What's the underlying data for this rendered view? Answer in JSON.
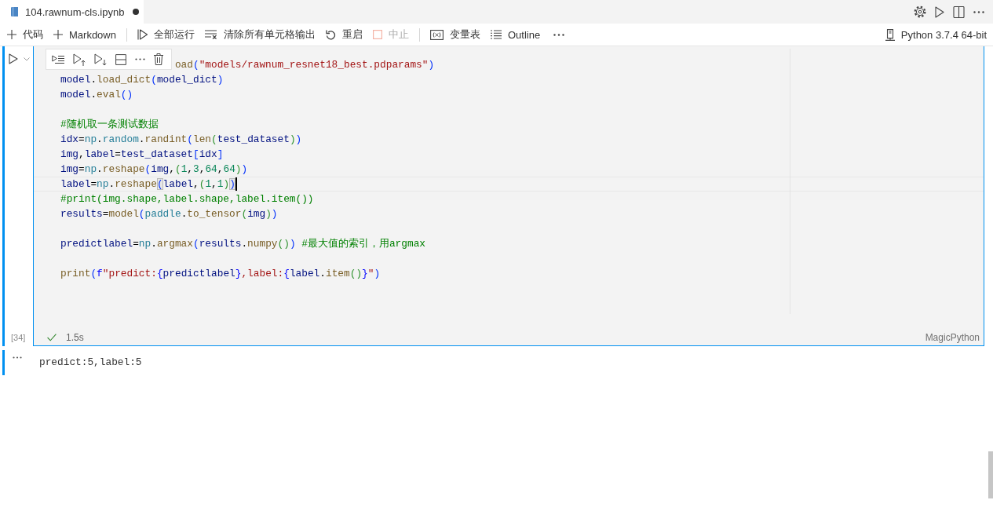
{
  "tab": {
    "title": "104.rawnum-cls.ipynb",
    "modified": true
  },
  "toolbar": {
    "groups": [
      [
        {
          "kind": "add",
          "label": "代码",
          "disabled": false
        },
        {
          "kind": "add",
          "label": "Markdown",
          "disabled": false
        }
      ],
      [
        {
          "kind": "run-all",
          "label": "全部运行",
          "disabled": false
        },
        {
          "kind": "clear",
          "label": "清除所有单元格输出",
          "disabled": false
        },
        {
          "kind": "restart",
          "label": "重启",
          "disabled": false
        },
        {
          "kind": "interrupt",
          "label": "中止",
          "disabled": true
        }
      ],
      [
        {
          "kind": "variables",
          "label": "变量表",
          "disabled": false
        },
        {
          "kind": "outline",
          "label": "Outline",
          "disabled": false
        }
      ]
    ]
  },
  "kernel": {
    "label": "Python 3.7.4 64-bit"
  },
  "cell": {
    "execution_count": "[34]",
    "succeeded": true,
    "duration": "1.5s",
    "language": "MagicPython",
    "lines": [
      {
        "kind": "covered",
        "current": false,
        "tokens": [
          {
            "kind": "function",
            "text": "oad"
          },
          {
            "kind": "bracket1",
            "text": "("
          },
          {
            "kind": "string",
            "text": "\"models/rawnum_resnet18_best.pdparams\""
          },
          {
            "kind": "bracket1",
            "text": ")"
          }
        ]
      },
      {
        "kind": "code",
        "current": false,
        "tokens": [
          {
            "kind": "variable",
            "text": "model"
          },
          {
            "kind": "text",
            "text": "."
          },
          {
            "kind": "function",
            "text": "load_dict"
          },
          {
            "kind": "bracket1",
            "text": "("
          },
          {
            "kind": "variable",
            "text": "model_dict"
          },
          {
            "kind": "bracket1",
            "text": ")"
          }
        ]
      },
      {
        "kind": "code",
        "current": false,
        "tokens": [
          {
            "kind": "variable",
            "text": "model"
          },
          {
            "kind": "text",
            "text": "."
          },
          {
            "kind": "function",
            "text": "eval"
          },
          {
            "kind": "bracket1",
            "text": "()"
          }
        ]
      },
      {
        "kind": "blank",
        "current": false
      },
      {
        "kind": "code",
        "current": false,
        "tokens": [
          {
            "kind": "comment",
            "text": "#随机取一条测试数据"
          }
        ]
      },
      {
        "kind": "code",
        "current": false,
        "tokens": [
          {
            "kind": "variable",
            "text": "idx"
          },
          {
            "kind": "text",
            "text": "="
          },
          {
            "kind": "module",
            "text": "np"
          },
          {
            "kind": "text",
            "text": "."
          },
          {
            "kind": "module",
            "text": "random"
          },
          {
            "kind": "text",
            "text": "."
          },
          {
            "kind": "function",
            "text": "randint"
          },
          {
            "kind": "bracket1",
            "text": "("
          },
          {
            "kind": "function",
            "text": "len"
          },
          {
            "kind": "bracket2",
            "text": "("
          },
          {
            "kind": "variable",
            "text": "test_dataset"
          },
          {
            "kind": "bracket2",
            "text": ")"
          },
          {
            "kind": "bracket1",
            "text": ")"
          }
        ]
      },
      {
        "kind": "code",
        "current": false,
        "tokens": [
          {
            "kind": "variable",
            "text": "img"
          },
          {
            "kind": "text",
            "text": ","
          },
          {
            "kind": "variable",
            "text": "label"
          },
          {
            "kind": "text",
            "text": "="
          },
          {
            "kind": "variable",
            "text": "test_dataset"
          },
          {
            "kind": "bracket1",
            "text": "["
          },
          {
            "kind": "variable",
            "text": "idx"
          },
          {
            "kind": "bracket1",
            "text": "]"
          }
        ]
      },
      {
        "kind": "code",
        "current": false,
        "tokens": [
          {
            "kind": "variable",
            "text": "img"
          },
          {
            "kind": "text",
            "text": "="
          },
          {
            "kind": "module",
            "text": "np"
          },
          {
            "kind": "text",
            "text": "."
          },
          {
            "kind": "function",
            "text": "reshape"
          },
          {
            "kind": "bracket1",
            "text": "("
          },
          {
            "kind": "variable",
            "text": "img"
          },
          {
            "kind": "text",
            "text": ","
          },
          {
            "kind": "bracket2",
            "text": "("
          },
          {
            "kind": "number",
            "text": "1"
          },
          {
            "kind": "text",
            "text": ","
          },
          {
            "kind": "number",
            "text": "3"
          },
          {
            "kind": "text",
            "text": ","
          },
          {
            "kind": "number",
            "text": "64"
          },
          {
            "kind": "text",
            "text": ","
          },
          {
            "kind": "number",
            "text": "64"
          },
          {
            "kind": "bracket2",
            "text": ")"
          },
          {
            "kind": "bracket1",
            "text": ")"
          }
        ]
      },
      {
        "kind": "code",
        "current": true,
        "tokens": [
          {
            "kind": "variable",
            "text": "label"
          },
          {
            "kind": "text",
            "text": "="
          },
          {
            "kind": "module",
            "text": "np"
          },
          {
            "kind": "text",
            "text": "."
          },
          {
            "kind": "function",
            "text": "reshape"
          },
          {
            "kind": "bracket-match",
            "text": "("
          },
          {
            "kind": "variable",
            "text": "label"
          },
          {
            "kind": "text",
            "text": ","
          },
          {
            "kind": "bracket2",
            "text": "("
          },
          {
            "kind": "number",
            "text": "1"
          },
          {
            "kind": "text",
            "text": ","
          },
          {
            "kind": "number",
            "text": "1"
          },
          {
            "kind": "bracket2",
            "text": ")"
          },
          {
            "kind": "bracket-match",
            "text": ")"
          }
        ]
      },
      {
        "kind": "code",
        "current": false,
        "tokens": [
          {
            "kind": "comment",
            "text": "#print(img.shape,label.shape,label.item())"
          }
        ]
      },
      {
        "kind": "code",
        "current": false,
        "tokens": [
          {
            "kind": "variable",
            "text": "results"
          },
          {
            "kind": "text",
            "text": "="
          },
          {
            "kind": "function",
            "text": "model"
          },
          {
            "kind": "bracket1",
            "text": "("
          },
          {
            "kind": "module",
            "text": "paddle"
          },
          {
            "kind": "text",
            "text": "."
          },
          {
            "kind": "function",
            "text": "to_tensor"
          },
          {
            "kind": "bracket2",
            "text": "("
          },
          {
            "kind": "variable",
            "text": "img"
          },
          {
            "kind": "bracket2",
            "text": ")"
          },
          {
            "kind": "bracket1",
            "text": ")"
          }
        ]
      },
      {
        "kind": "blank",
        "current": false
      },
      {
        "kind": "code",
        "current": false,
        "tokens": [
          {
            "kind": "variable",
            "text": "predictlabel"
          },
          {
            "kind": "text",
            "text": "="
          },
          {
            "kind": "module",
            "text": "np"
          },
          {
            "kind": "text",
            "text": "."
          },
          {
            "kind": "function",
            "text": "argmax"
          },
          {
            "kind": "bracket1",
            "text": "("
          },
          {
            "kind": "variable",
            "text": "results"
          },
          {
            "kind": "text",
            "text": "."
          },
          {
            "kind": "function",
            "text": "numpy"
          },
          {
            "kind": "bracket2",
            "text": "()"
          },
          {
            "kind": "bracket1",
            "text": ")"
          },
          {
            "kind": "comment",
            "text": " #最大值的索引，用argmax"
          }
        ]
      },
      {
        "kind": "blank",
        "current": false
      },
      {
        "kind": "code",
        "current": false,
        "tokens": [
          {
            "kind": "function",
            "text": "print"
          },
          {
            "kind": "bracket1",
            "text": "("
          },
          {
            "kind": "keyword",
            "text": "f"
          },
          {
            "kind": "string",
            "text": "\"predict:"
          },
          {
            "kind": "keyword",
            "text": "{"
          },
          {
            "kind": "variable",
            "text": "predictlabel"
          },
          {
            "kind": "keyword",
            "text": "}"
          },
          {
            "kind": "string",
            "text": ",label:"
          },
          {
            "kind": "keyword",
            "text": "{"
          },
          {
            "kind": "variable",
            "text": "label"
          },
          {
            "kind": "text",
            "text": "."
          },
          {
            "kind": "function",
            "text": "item"
          },
          {
            "kind": "bracket2",
            "text": "()"
          },
          {
            "kind": "keyword",
            "text": "}"
          },
          {
            "kind": "string",
            "text": "\""
          },
          {
            "kind": "bracket1",
            "text": ")"
          }
        ]
      }
    ]
  },
  "output": {
    "text": "predict:5,label:5"
  }
}
